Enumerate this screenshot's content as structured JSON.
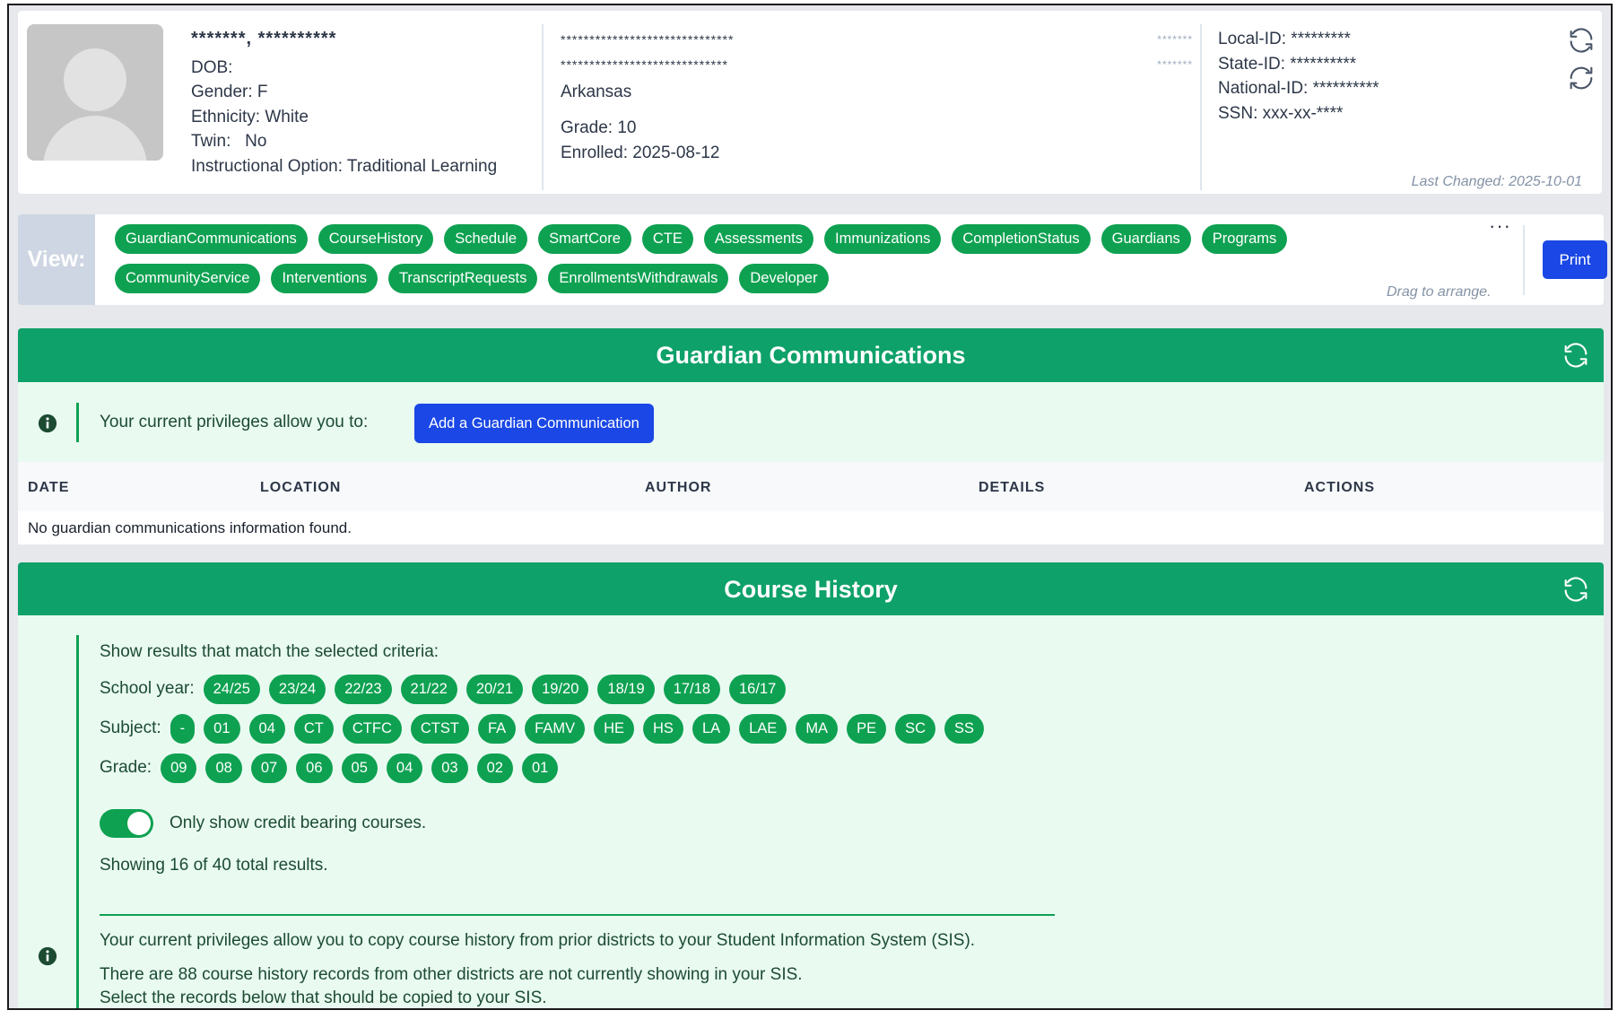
{
  "student": {
    "name": "*******, **********",
    "dob": "DOB:",
    "gender": "Gender: F",
    "ethnicity": "Ethnicity: White",
    "twin": "Twin:   No",
    "instructional_option": "Instructional Option: Traditional Learning"
  },
  "enrollment": {
    "school_line1": "******************************",
    "school_line1_right": "*******",
    "school_line2": "*****************************",
    "school_line2_right": "*******",
    "state": "Arkansas",
    "grade": "Grade: 10",
    "enrolled": "Enrolled: 2025-08-12"
  },
  "ids": {
    "local_id": "Local-ID: *********",
    "state_id": "State-ID: **********",
    "national_id": "National-ID: **********",
    "ssn": "SSN: xxx-xx-****",
    "last_changed": "Last Changed: 2025-10-01"
  },
  "viewbar": {
    "label": "View:",
    "row1": [
      "GuardianCommunications",
      "CourseHistory",
      "Schedule",
      "SmartCore",
      "CTE",
      "Assessments",
      "Immunizations",
      "CompletionStatus",
      "Guardians",
      "Programs"
    ],
    "row2": [
      "CommunityService",
      "Interventions",
      "TranscriptRequests",
      "EnrollmentsWithdrawals",
      "Developer"
    ],
    "more": "···",
    "drag_hint": "Drag to arrange.",
    "print_label": "Print"
  },
  "guardian_comms": {
    "title": "Guardian Communications",
    "privileges_text": "Your current privileges allow you to:",
    "add_button": "Add a Guardian Communication",
    "columns": [
      "DATE",
      "LOCATION",
      "AUTHOR",
      "DETAILS",
      "ACTIONS"
    ],
    "empty_message": "No guardian communications information found."
  },
  "course_history": {
    "title": "Course History",
    "criteria_heading": "Show results that match the selected criteria:",
    "school_year_label": "School year:",
    "school_years": [
      "24/25",
      "23/24",
      "22/23",
      "21/22",
      "20/21",
      "19/20",
      "18/19",
      "17/18",
      "16/17"
    ],
    "subject_label": "Subject:",
    "subjects": [
      "-",
      "01",
      "04",
      "CT",
      "CTFC",
      "CTST",
      "FA",
      "FAMV",
      "HE",
      "HS",
      "LA",
      "LAE",
      "MA",
      "PE",
      "SC",
      "SS"
    ],
    "grade_label": "Grade:",
    "grades": [
      "09",
      "08",
      "07",
      "06",
      "05",
      "04",
      "03",
      "02",
      "01"
    ],
    "credit_toggle_label": "Only show credit bearing courses.",
    "credit_toggle_on": true,
    "showing_text": "Showing 16 of 40 total results.",
    "copy_line1": "Your current privileges allow you to copy course history from prior districts to your Student Information System (SIS).",
    "copy_line2": "There are 88 course history records from other districts are not currently showing in your SIS.",
    "copy_line3": "Select the records below that should be copied to your SIS."
  },
  "colors": {
    "accent_green": "#0ea151",
    "header_green": "#0ea169",
    "primary_blue": "#1a47e5",
    "section_bg": "#e9faf1"
  }
}
